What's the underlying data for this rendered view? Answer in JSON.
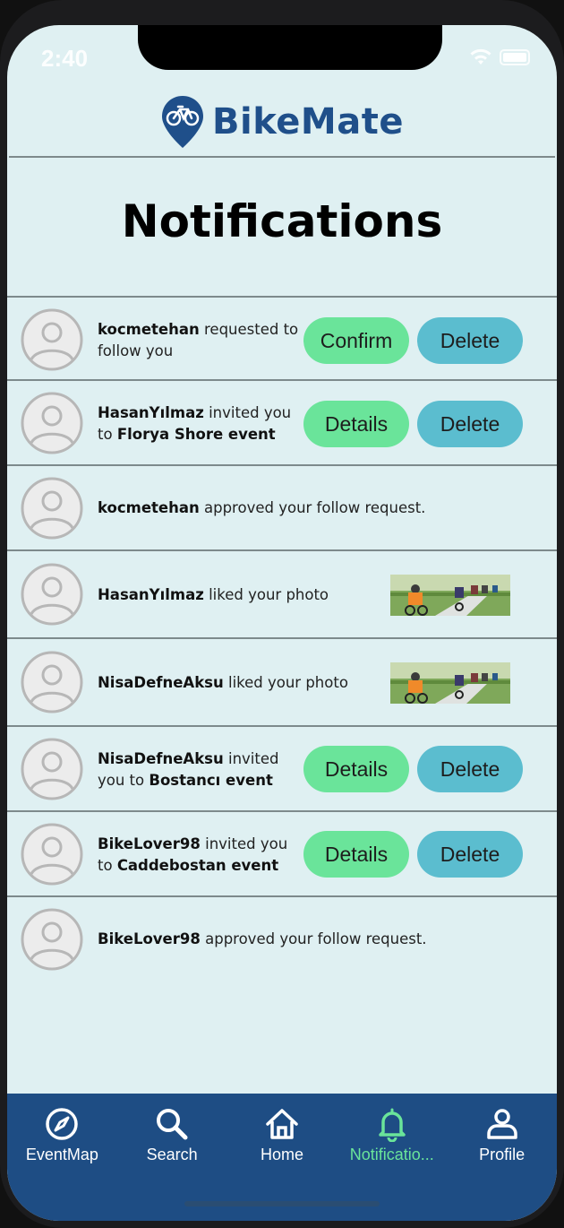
{
  "status_bar": {
    "time": "2:40"
  },
  "app": {
    "name": "BikeMate"
  },
  "page": {
    "title": "Notifications"
  },
  "notifications": [
    {
      "user": "kocmetehan",
      "text": " requested to follow you",
      "event": "",
      "actions": [
        "Confirm",
        "Delete"
      ]
    },
    {
      "user": "HasanYılmaz",
      "text": " invited you to ",
      "event": "Florya Shore event",
      "actions": [
        "Details",
        "Delete"
      ]
    },
    {
      "user": "kocmetehan",
      "text": " approved your follow request.",
      "event": "",
      "actions": []
    },
    {
      "user": "HasanYılmaz",
      "text": " liked your photo",
      "event": "",
      "actions": [],
      "thumbnail": "cyclists-photo"
    },
    {
      "user": "NisaDefneAksu",
      "text": " liked your photo",
      "event": "",
      "actions": [],
      "thumbnail": "cyclists-photo"
    },
    {
      "user": "NisaDefneAksu",
      "text": " invited you to ",
      "event": "Bostancı event",
      "actions": [
        "Details",
        "Delete"
      ]
    },
    {
      "user": "BikeLover98",
      "text": " invited you to ",
      "event": "Caddebostan event",
      "actions": [
        "Details",
        "Delete"
      ]
    },
    {
      "user": "BikeLover98",
      "text": " approved your follow request.",
      "event": "",
      "actions": []
    }
  ],
  "tabbar": {
    "items": [
      {
        "label": "EventMap",
        "icon": "compass-icon",
        "active": false
      },
      {
        "label": "Search",
        "icon": "search-icon",
        "active": false
      },
      {
        "label": "Home",
        "icon": "home-icon",
        "active": false
      },
      {
        "label": "Notificatio...",
        "icon": "bell-icon",
        "active": true
      },
      {
        "label": "Profile",
        "icon": "person-icon",
        "active": false
      }
    ]
  },
  "colors": {
    "background": "#dff0f2",
    "brand": "#1f4f8a",
    "confirm_green": "#6ae49a",
    "delete_blue": "#5bbdcf",
    "tabbar": "#1e4d84",
    "active_tab": "#6ae49a"
  }
}
